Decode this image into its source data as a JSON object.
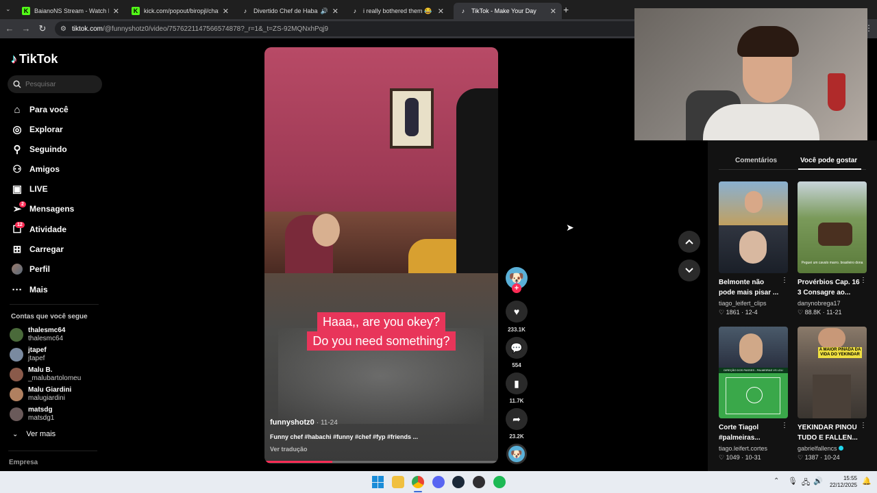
{
  "browser": {
    "tabs": [
      {
        "title": "BaianoNS Stream - Watch Live",
        "icon": "kick-icon",
        "color": "#53fc18"
      },
      {
        "title": "kick.com/popout/biropjl/chat",
        "icon": "kick-icon",
        "color": "#53fc18"
      },
      {
        "title": "Divertido Chef de Habachi",
        "icon": "tiktok-icon",
        "color": "#000000"
      },
      {
        "title": "i really bothered them 😂 #flo",
        "icon": "tiktok-icon",
        "color": "#000000"
      },
      {
        "title": "TikTok - Make Your Day",
        "icon": "tiktok-icon",
        "color": "#000000"
      }
    ],
    "url_host": "tiktok.com",
    "url_path": "/@funnyshotz0/video/7576221147566574878?_r=1&_t=ZS-92MQNxhPqj9"
  },
  "sidebar": {
    "logo": "TikTok",
    "search_placeholder": "Pesquisar",
    "nav": [
      {
        "label": "Para você",
        "icon": "home-icon"
      },
      {
        "label": "Explorar",
        "icon": "compass-icon"
      },
      {
        "label": "Seguindo",
        "icon": "following-icon"
      },
      {
        "label": "Amigos",
        "icon": "friends-icon"
      },
      {
        "label": "LIVE",
        "icon": "live-icon"
      },
      {
        "label": "Mensagens",
        "icon": "message-icon",
        "badge": "2"
      },
      {
        "label": "Atividade",
        "icon": "activity-icon",
        "badge": "12"
      },
      {
        "label": "Carregar",
        "icon": "upload-icon"
      },
      {
        "label": "Perfil",
        "icon": "profile-avatar-icon"
      },
      {
        "label": "Mais",
        "icon": "more-icon"
      }
    ],
    "following_header": "Contas que você segue",
    "following": [
      {
        "name": "thalesmc64",
        "handle": "thalesmc64",
        "color": "#4a6a3a"
      },
      {
        "name": "jtapef",
        "handle": "jtapef",
        "color": "#7a8aa0"
      },
      {
        "name": "Malu B.",
        "handle": "_malubartolomeu",
        "color": "#8a5a4a"
      },
      {
        "name": "Malu Giardini",
        "handle": "malugiardini",
        "color": "#b08060"
      },
      {
        "name": "matsdg",
        "handle": "matsdg1",
        "color": "#6a5a5a"
      }
    ],
    "see_more": "Ver mais",
    "footer": "Empresa"
  },
  "video": {
    "caption_line1": "Haaa,, are you okey?",
    "caption_line2": "Do you need something?",
    "author": "funnyshotz0",
    "date": "· 11-24",
    "description": "Funny chef #habachi #funny #chef #fyp #friends ...",
    "translate": "Ver tradução",
    "progress": 0.29
  },
  "actions": {
    "likes": "233.1K",
    "comments": "554",
    "saves": "11.7K",
    "shares": "23.2K"
  },
  "panel": {
    "tab_comments": "Comentários",
    "tab_recommend": "Você pode gostar",
    "cards": [
      {
        "title": "Belmonte não pode mais pisar ...",
        "author": "tiago_leifert_clips",
        "likes": "1861",
        "date": "12-4",
        "verified": false
      },
      {
        "title": "Provérbios Cap. 16 3 Consagre ao...",
        "author": "danynobrega17",
        "likes": "88.8K",
        "date": "11-21",
        "verified": false
      },
      {
        "title": "Corte Tiagol #palmeiras...",
        "author": "tiago.leifert.cortes",
        "likes": "1049",
        "date": "10-31",
        "verified": false
      },
      {
        "title": "YEKINDAR PINOU TUDO E FALLEN...",
        "author": "gabrielfallencs",
        "likes": "1387",
        "date": "10-24",
        "verified": true
      }
    ],
    "thumb4_banner": "A MAIOR PINADA DA VIDA DO YEKINDAR",
    "thumb3_banner": "DIREÇÃO DOS PASSES - PALMEIRAS VS LDU",
    "thumb2_caption": "Peguei um cavalo marro. brasileiro dona"
  },
  "taskbar": {
    "time": "15:55",
    "date": "22/12/2025"
  }
}
